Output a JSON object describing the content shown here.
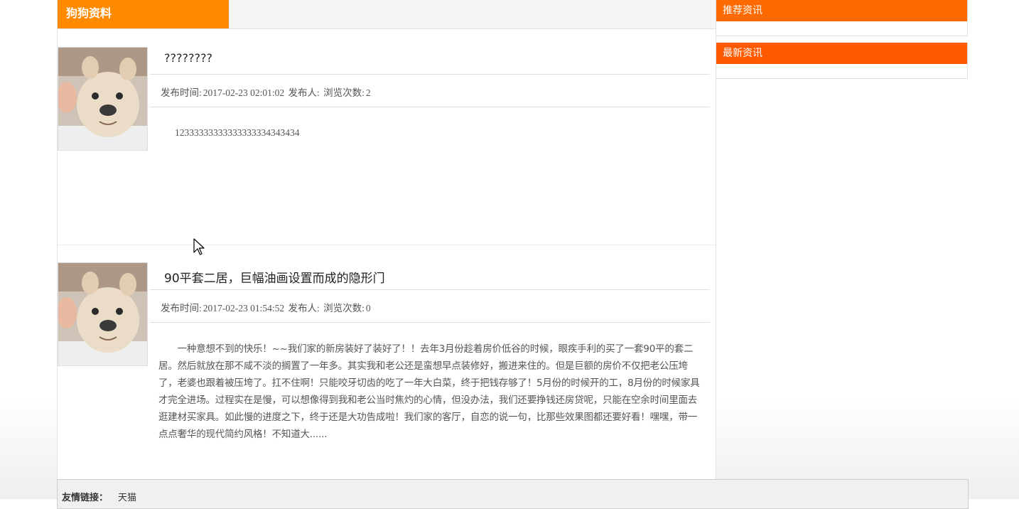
{
  "section": {
    "title": "狗狗资料"
  },
  "sidebar": {
    "boxes": [
      {
        "title": "推荐资讯"
      },
      {
        "title": "最新资讯"
      }
    ]
  },
  "articles": [
    {
      "title": "????????",
      "publish_label": "发布时间:",
      "publish_time": "2017-02-23 02:01:02",
      "author_label": "发布人:",
      "views_label": "浏览次数:",
      "views": "2",
      "body": "12333333333333333334343434",
      "thumb_icon": "dog-photo"
    },
    {
      "title": "90平套二居，巨幅油画设置而成的隐形门",
      "publish_label": "发布时间:",
      "publish_time": "2017-02-23 01:54:52",
      "author_label": "发布人:",
      "views_label": "浏览次数:",
      "views": "0",
      "body": "　　一种意想不到的快乐！~~我们家的新房装好了装好了！！去年3月份趁着房价低谷的时候，眼疾手利的买了一套90平的套二居。然后就放在那不咸不淡的搁置了一年多。其实我和老公还是蛮想早点装修好，搬进来住的。但是巨额的房价不仅把老公压垮了，老婆也跟着被压垮了。扛不住啊！只能咬牙切齿的吃了一年大白菜，终于把钱存够了！5月份的时候开的工，8月份的时候家具才完全进场。过程实在是慢，可以想像得到我和老公当时焦灼的心情，但没办法，我们还要挣钱还房贷呢，只能在空余时间里面去逛建材买家具。如此慢的进度之下，终于还是大功告成啦！我们家的客厅，自恋的说一句，比那些效果图都还要好看！嘿嘿，带一点点奢华的现代简约风格！不知道大......",
      "thumb_icon": "dog-photo"
    }
  ],
  "footer": {
    "label": "友情链接：",
    "links": [
      "天猫"
    ]
  },
  "colors": {
    "section_title_bg": "#ff8a00",
    "sidebar_head_bg": "#ff5a00"
  },
  "icons": {
    "cursor": "arrow-cursor-icon"
  }
}
